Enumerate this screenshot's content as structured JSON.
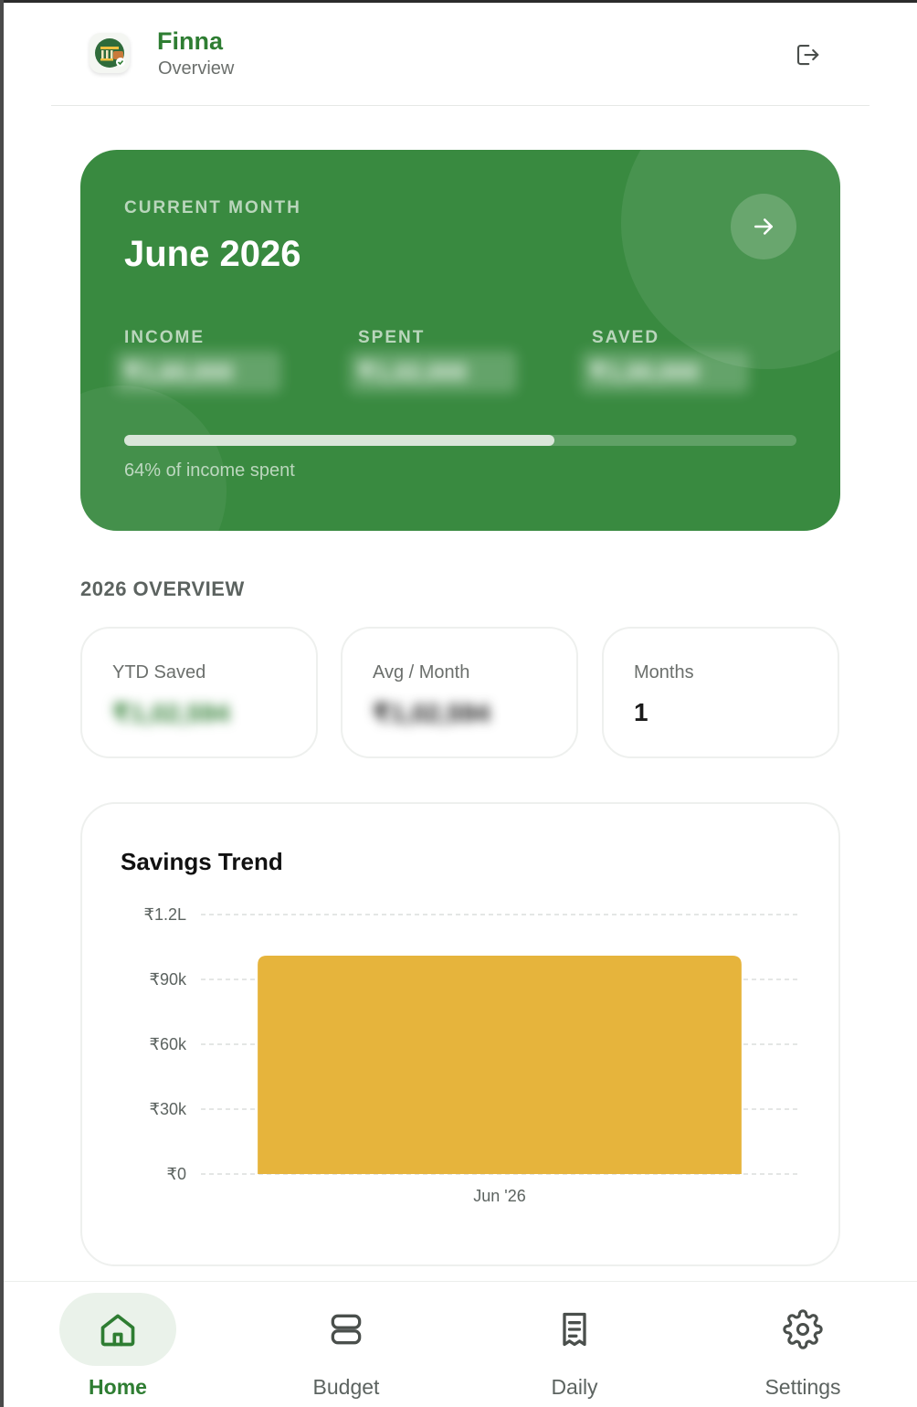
{
  "header": {
    "app_name": "Finna",
    "page_name": "Overview",
    "logout_icon": "logout-icon"
  },
  "month_card": {
    "label": "CURRENT MONTH",
    "month": "June 2026",
    "stats": [
      {
        "label": "INCOME",
        "value": "₹1,60,000"
      },
      {
        "label": "SPENT",
        "value": "₹1,02,000"
      },
      {
        "label": "SAVED",
        "value": "₹1,00,000"
      }
    ],
    "progress_percent": 64,
    "progress_text": "64% of income spent",
    "accent_color": "#398a40"
  },
  "overview": {
    "heading": "2026 OVERVIEW",
    "tiles": [
      {
        "label": "YTD Saved",
        "value": "₹1,02,594"
      },
      {
        "label": "Avg / Month",
        "value": "₹1,02,594"
      },
      {
        "label": "Months",
        "value": "1"
      }
    ]
  },
  "chart_data": {
    "type": "bar",
    "title": "Savings Trend",
    "categories": [
      "Jun '26"
    ],
    "values": [
      101000
    ],
    "ylim": [
      0,
      120000
    ],
    "yticks": [
      0,
      30000,
      60000,
      90000,
      120000
    ],
    "ytick_labels": [
      "₹0",
      "₹30k",
      "₹60k",
      "₹90k",
      "₹1.2L"
    ],
    "grid": true,
    "bar_color": "#e6b43c",
    "xlabel": "",
    "ylabel": ""
  },
  "nav": {
    "items": [
      {
        "label": "Home",
        "icon": "home-icon",
        "active": true
      },
      {
        "label": "Budget",
        "icon": "budget-icon",
        "active": false
      },
      {
        "label": "Daily",
        "icon": "receipt-icon",
        "active": false
      },
      {
        "label": "Settings",
        "icon": "gear-icon",
        "active": false
      }
    ]
  }
}
